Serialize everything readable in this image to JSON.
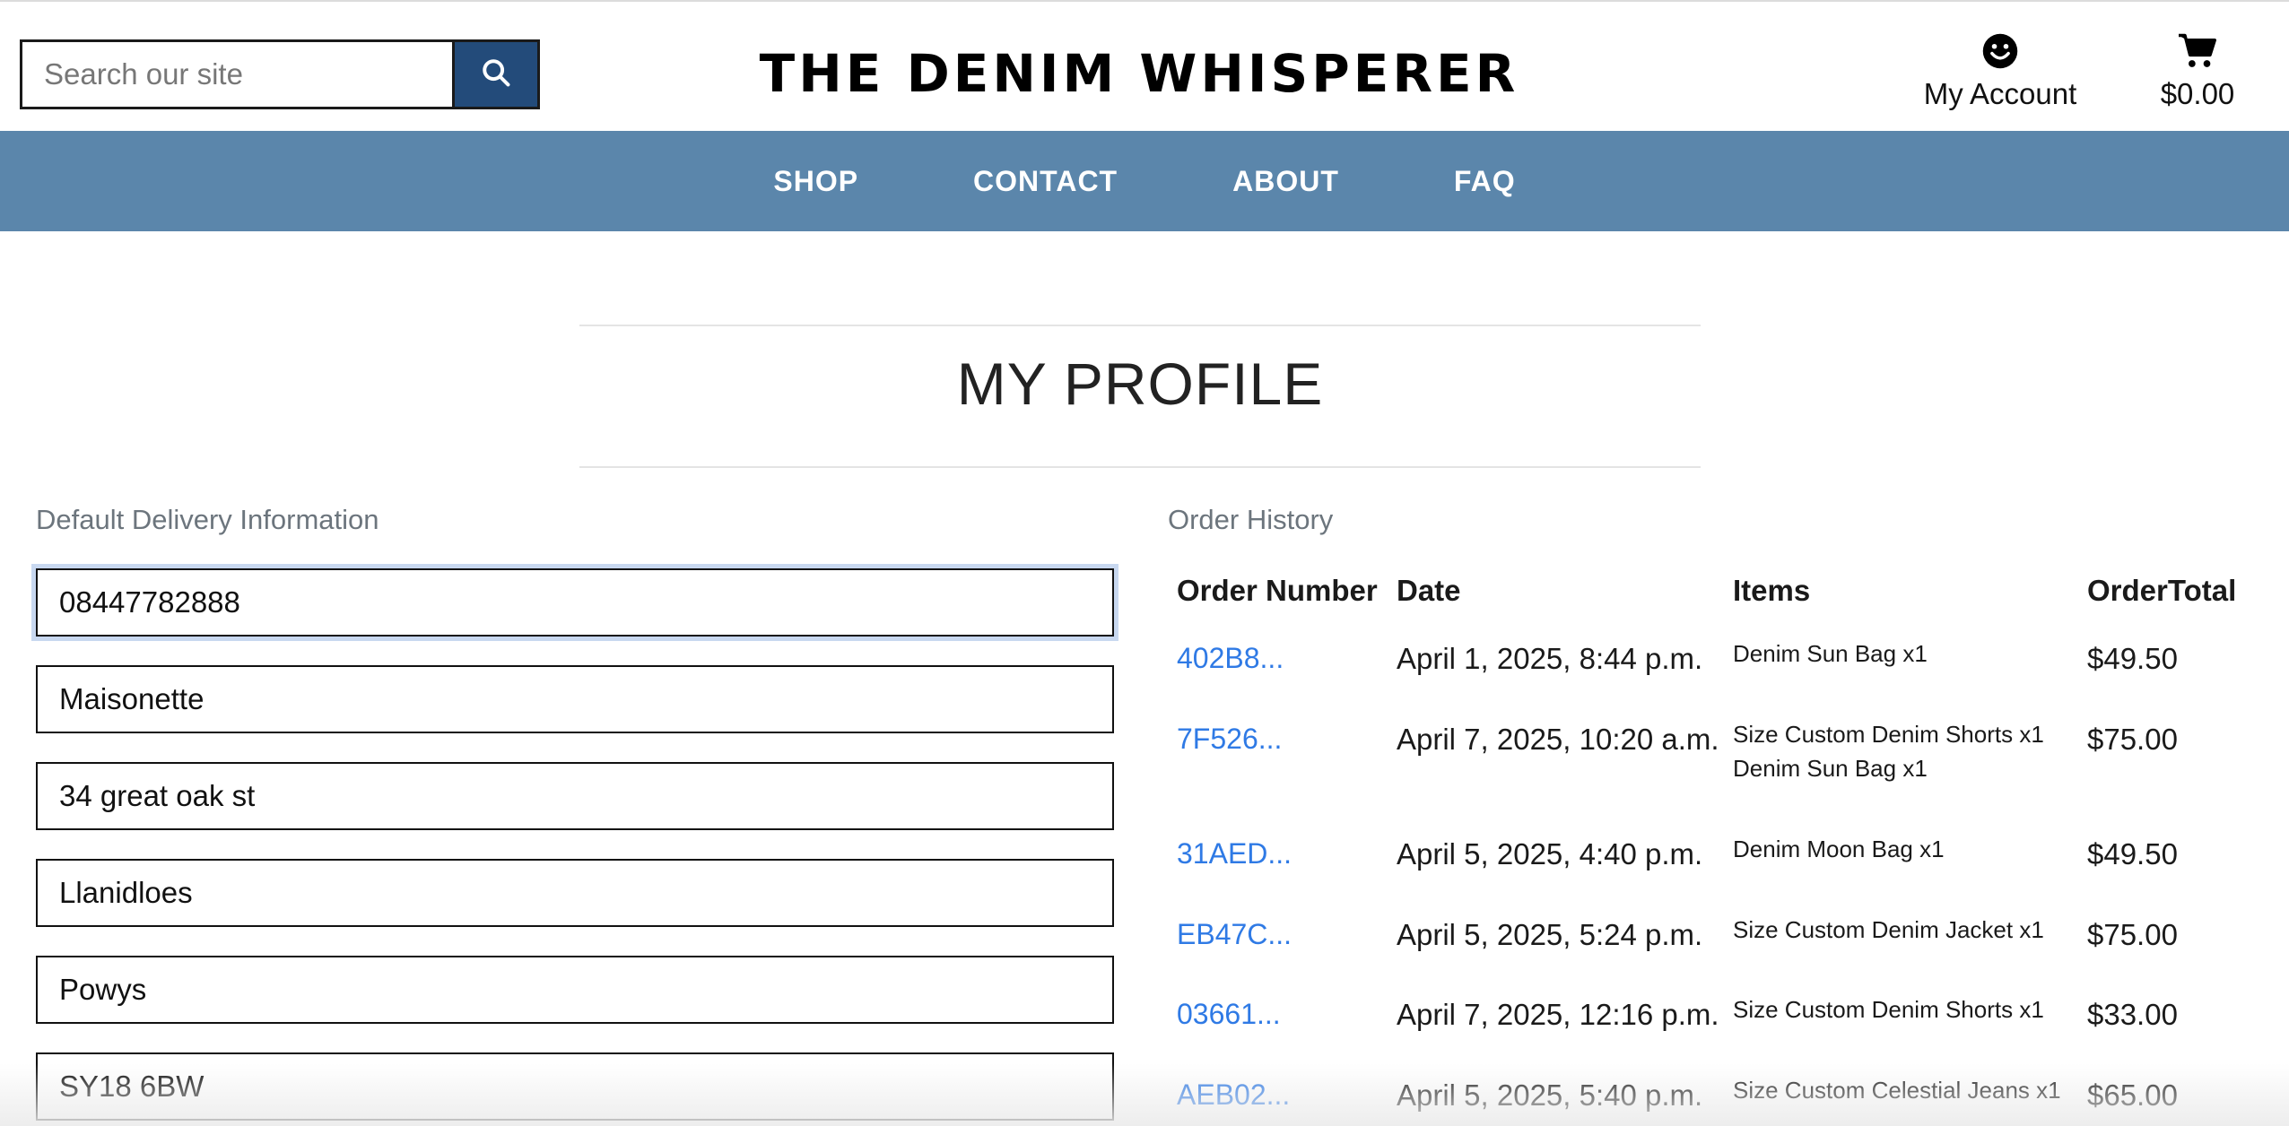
{
  "header": {
    "search_placeholder": "Search our site",
    "logo_text": "THE DENIM WHISPERER",
    "account_label": "My Account",
    "cart_total": "$0.00"
  },
  "nav": {
    "items": [
      {
        "label": "SHOP"
      },
      {
        "label": "CONTACT"
      },
      {
        "label": "ABOUT"
      },
      {
        "label": "FAQ"
      }
    ]
  },
  "page": {
    "title": "MY PROFILE"
  },
  "delivery": {
    "label": "Default Delivery Information",
    "fields": [
      {
        "value": "08447782888"
      },
      {
        "value": "Maisonette"
      },
      {
        "value": "34 great oak st"
      },
      {
        "value": "Llanidloes"
      },
      {
        "value": "Powys"
      },
      {
        "value": "SY18 6BW"
      }
    ]
  },
  "orders": {
    "label": "Order History",
    "headers": {
      "number": "Order Number",
      "date": "Date",
      "items": "Items",
      "total": "OrderTotal"
    },
    "rows": [
      {
        "number": "402B8...",
        "date": "April 1, 2025, 8:44 p.m.",
        "items": [
          "Denim Sun Bag x1"
        ],
        "total": "$49.50"
      },
      {
        "number": "7F526...",
        "date": "April 7, 2025, 10:20 a.m.",
        "items": [
          "Size Custom Denim Shorts x1",
          "Denim Sun Bag x1"
        ],
        "total": "$75.00"
      },
      {
        "number": "31AED...",
        "date": "April 5, 2025, 4:40 p.m.",
        "items": [
          "Denim Moon Bag x1"
        ],
        "total": "$49.50"
      },
      {
        "number": "EB47C...",
        "date": "April 5, 2025, 5:24 p.m.",
        "items": [
          "Size Custom Denim Jacket x1"
        ],
        "total": "$75.00"
      },
      {
        "number": "03661...",
        "date": "April 7, 2025, 12:16 p.m.",
        "items": [
          "Size Custom Denim Shorts x1"
        ],
        "total": "$33.00"
      },
      {
        "number": "AEB02...",
        "date": "April 5, 2025, 5:40 p.m.",
        "items": [
          "Size Custom Celestial Jeans x1"
        ],
        "total": "$65.00"
      }
    ]
  },
  "colors": {
    "nav_bg": "#5b86ab",
    "search_button": "#234b7a",
    "link": "#2f7ae5"
  },
  "icons": {
    "search": "search-icon",
    "account": "smiley-icon",
    "cart": "cart-icon"
  }
}
